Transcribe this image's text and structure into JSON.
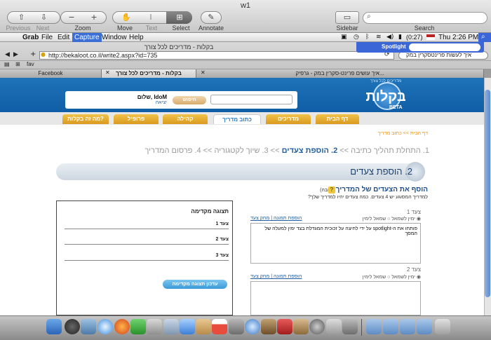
{
  "preview_app": {
    "window_title": "w1",
    "toolbar": {
      "previous": "Previous",
      "next": "Next",
      "zoom": "Zoom",
      "move": "Move",
      "text": "Text",
      "select": "Select",
      "annotate": "Annotate",
      "sidebar": "Sidebar",
      "search": "Search"
    }
  },
  "menubar": {
    "app_name": "Grab",
    "items": [
      "File",
      "Edit",
      "Capture",
      "Window",
      "Help"
    ],
    "battery": "(0:27)",
    "clock": "Thu 2:26 PM",
    "spotlight_label": "Spotlight"
  },
  "browser": {
    "title": "בקלות - מדריכים לכל צורך",
    "url": "http://bekaloot.co.il/write2.aspx?id=735",
    "search_text": "איך לעשות פרינטסקרין במק",
    "bookmark": "fav",
    "tabs": [
      {
        "label": "Facebook"
      },
      {
        "label": "בקלות - מדריכים לכל צורך"
      },
      {
        "label": "איך עושים פרינט-סקרין במק - גרפיק..."
      }
    ]
  },
  "site": {
    "logo": "בקלות",
    "logo_tagline": "מדריכים לכל צורך",
    "logo_beta": "BETA",
    "login_button": "חיפוש",
    "greeting": "שלום, IdoM",
    "logout": "יציאה",
    "nav": [
      "דף הבית",
      "מדריכים",
      "כתוב מדריך",
      "קהילה",
      "פרופיל",
      "מה זה בקלות?"
    ],
    "breadcrumb": "דף הבית >> כתוב מדריך",
    "steps_before": "1. התחלת תהליך כתיבה >> ",
    "steps_current": "2. הוספת צעדים",
    "steps_after": " >> 3. שיוך לקטגוריה >> 4. פרסום המדריך",
    "section_title": "2. הוספת צעדים",
    "add_title": "הוסף את הצעדים של המדריך",
    "add_required": "(חובה)",
    "add_desc": "למדריך המסוגע יש 4 צעדים. כמה צעדים יהיו למדריך שלך?",
    "preview": {
      "heading": "תצוגה מקדימה",
      "steps": [
        "צעד 1",
        "צעד 2",
        "צעד 3"
      ],
      "update_button": "עדכון תצוגה מקדימה"
    },
    "editor": {
      "align_options": "◉ ימין לשמאל ○ שמאל לימין",
      "delete_step": "מחק צעד",
      "add_image": "הוספת תמונה",
      "step1_label": "צעד 1",
      "step1_text": "פותחו את ה-spotlight על ידי לחיצה על זכוכית המגדלת בצד ימין למעלה של המסך",
      "step2_label": "צעד 2",
      "step2_text": ""
    }
  }
}
